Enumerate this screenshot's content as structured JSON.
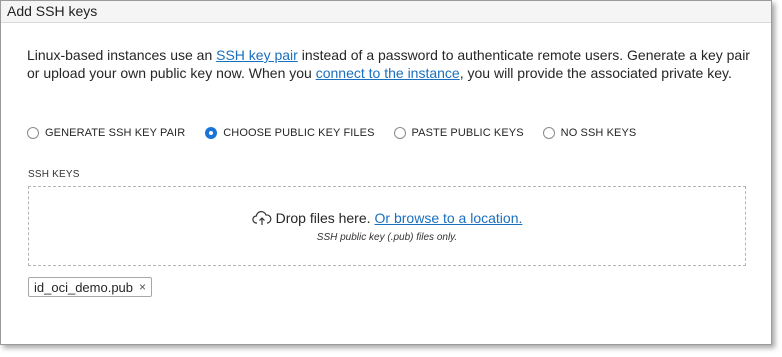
{
  "panel": {
    "title": "Add SSH keys"
  },
  "description": {
    "text_before_link1": "Linux-based instances use an ",
    "link1": "SSH key pair",
    "text_between": " instead of a password to authenticate remote users. Generate a key pair or upload your own public key now. When you ",
    "link2": "connect to the instance",
    "text_after": ", you will provide the associated private key."
  },
  "options": {
    "generate": "GENERATE SSH KEY PAIR",
    "choose": "CHOOSE PUBLIC KEY FILES",
    "paste": "PASTE PUBLIC KEYS",
    "none": "NO SSH KEYS",
    "selected": "CHOOSE PUBLIC KEY FILES"
  },
  "ssh_keys": {
    "label": "SSH KEYS",
    "drop_text": "Drop files here.",
    "browse_link": "Or browse to a location.",
    "hint": "SSH public key (.pub) files only.",
    "upload_icon": "cloud-upload-icon"
  },
  "files": [
    {
      "name": "id_oci_demo.pub",
      "remove_label": "×"
    }
  ],
  "colors": {
    "accent": "#1a73d9",
    "link": "#1a6fbf"
  }
}
